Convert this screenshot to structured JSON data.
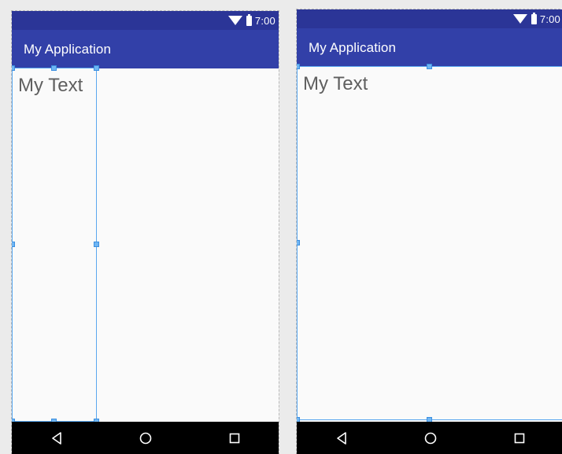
{
  "previews": [
    {
      "status_bar": {
        "time": "7:00",
        "icons": [
          "wifi-icon",
          "battery-icon"
        ]
      },
      "app_bar": {
        "title": "My Application"
      },
      "text_view": {
        "text": "My Text"
      },
      "nav_bar": {
        "buttons": [
          "back-icon",
          "home-icon",
          "recents-icon"
        ]
      }
    },
    {
      "status_bar": {
        "time": "7:00",
        "icons": [
          "wifi-icon",
          "battery-icon"
        ]
      },
      "app_bar": {
        "title": "My Application"
      },
      "text_view": {
        "text": "My Text"
      },
      "nav_bar": {
        "buttons": [
          "back-icon",
          "home-icon",
          "recents-icon"
        ]
      }
    }
  ],
  "colors": {
    "status_bar": "#2b3597",
    "app_bar": "#3240a8",
    "selection": "#5aa7ef",
    "text": "#5f5f5f"
  }
}
